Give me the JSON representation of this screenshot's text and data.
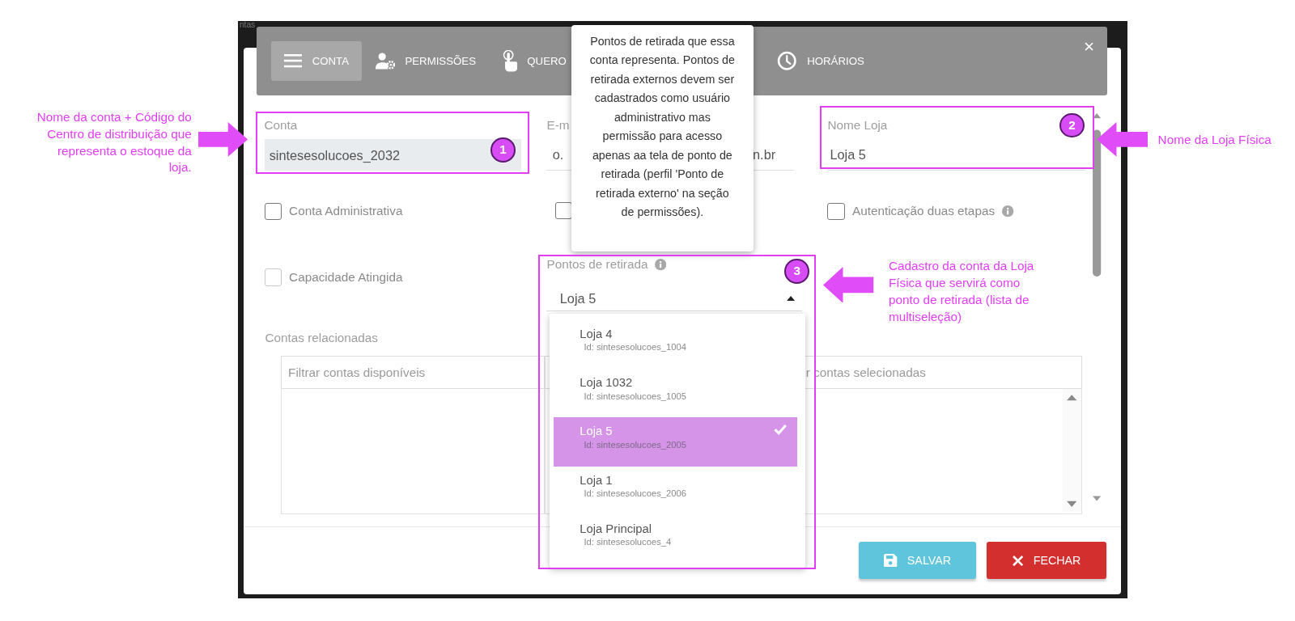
{
  "background_title": "ntas",
  "dialog": {
    "tabs": [
      {
        "label": "CONTA",
        "selected": true
      },
      {
        "label": "PERMISSÕES",
        "selected": false
      },
      {
        "label": "QUERO",
        "selected": false
      },
      {
        "label": "HORÁRIOS",
        "selected": false
      }
    ],
    "close": "×",
    "account": {
      "label": "Conta",
      "value": "sintesesolucoes_2032",
      "readonly": true
    },
    "email": {
      "label": "E-m",
      "value_parts": [
        "o.",
        "n.br"
      ]
    },
    "store_name": {
      "label": "Nome Loja",
      "value": "Loja 5"
    },
    "checkboxes": [
      {
        "label": "Conta Administrativa",
        "checked": false,
        "disabled": false
      },
      {
        "checked": false,
        "disabled": false
      },
      {
        "label": "Autenticação duas etapas",
        "checked": false,
        "disabled": false,
        "info": true
      },
      {
        "label": "Capacidade Atingida",
        "checked": false,
        "disabled": true
      }
    ],
    "pickup": {
      "label": "Pontos de retirada",
      "info": true,
      "value": "Loja 5",
      "expanded": true,
      "options": [
        {
          "name": "Loja 4",
          "id": "Id: sintesesolucoes_1004",
          "selected": false
        },
        {
          "name": "Loja 1032",
          "id": "Id: sintesesolucoes_1005",
          "selected": false
        },
        {
          "name": "Loja 5",
          "id": "Id: sintesesolucoes_2005",
          "selected": true
        },
        {
          "name": "Loja 1",
          "id": "Id: sintesesolucoes_2006",
          "selected": false
        },
        {
          "name": "Loja Principal",
          "id": "Id: sintesesolucoes_4",
          "selected": false
        }
      ]
    },
    "related": {
      "label": "Contas relacionadas",
      "available_placeholder": "Filtrar contas disponíveis",
      "selected_placeholder": "r contas selecionadas"
    },
    "buttons": [
      {
        "label": "SALVAR",
        "kind": "save"
      },
      {
        "label": "FECHAR",
        "kind": "close"
      }
    ]
  },
  "tooltip": {
    "text": "Pontos de retirada que essa conta representa. Pontos de retirada externos devem ser cadastrados como usuário administrativo mas permissão para acesso apenas aa tela de ponto de retirada (perfil 'Ponto de retirada externo' na seção de permissões)."
  },
  "annotations": [
    {
      "number": "1",
      "text": "Nome da conta + Código do Centro de distribuição que representa o estoque da loja."
    },
    {
      "number": "2",
      "text": "Nome da Loja Física"
    },
    {
      "number": "3",
      "text": "Cadastro da conta da Loja Física que servirá como ponto de retirada (lista de multiseleção)"
    }
  ]
}
